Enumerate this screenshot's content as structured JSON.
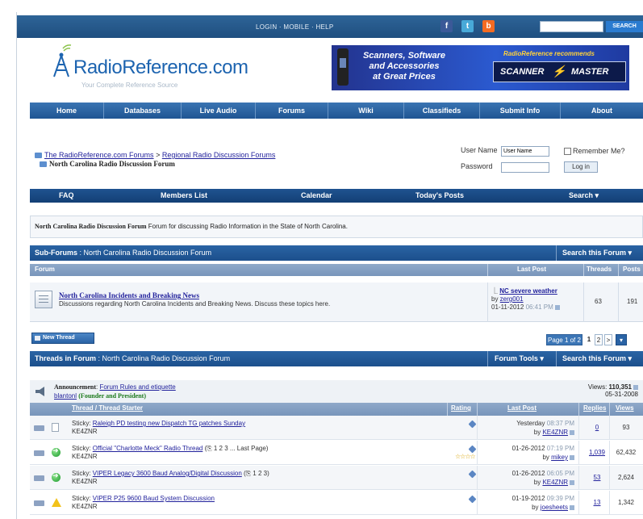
{
  "topbar": {
    "links": "LOGIN · MOBILE · HELP",
    "social": [
      "f",
      "t",
      "b"
    ],
    "search_button": "SEARCH"
  },
  "logo": {
    "name": "RadioReference.com",
    "tagline": "Your Complete Reference Source"
  },
  "banner": {
    "line1": "Scanners, Software",
    "line2": "and Accessories",
    "line3": "at Great Prices",
    "recommends": "RadioReference recommends",
    "brand_left": "SCANNER",
    "brand_right": "MASTER"
  },
  "nav": [
    "Home",
    "Databases",
    "Live Audio",
    "Forums",
    "Wiki",
    "Classifieds",
    "Submit Info",
    "About"
  ],
  "breadcrumb": {
    "link1": "The RadioReference.com Forums",
    "sep": " > ",
    "link2": "Regional Radio Discussion Forums",
    "current": "North Carolina Radio Discussion Forum"
  },
  "login": {
    "username_label": "User Name",
    "username_value": "User Name",
    "remember_label": "Remember Me?",
    "password_label": "Password",
    "button": "Log in"
  },
  "subnav": [
    "FAQ",
    "Members List",
    "Calendar",
    "Today's Posts",
    "Search ▾"
  ],
  "description": {
    "title": "North Carolina Radio Discussion Forum",
    "text": " Forum for discussing Radio Information in the State of North Carolina."
  },
  "subforums": {
    "bar_title": "Sub-Forums",
    "bar_rest": " : North Carolina Radio Discussion Forum",
    "search": "Search this Forum ▾",
    "col_forum": "Forum",
    "col_lastpost": "Last Post",
    "col_threads": "Threads",
    "col_posts": "Posts",
    "row": {
      "title": "North Carolina Incidents and Breaking News",
      "desc": "Discussions regarding North Carolina Incidents and Breaking News. Discuss these topics here.",
      "lp_title": "NC severe weather",
      "lp_by": "by ",
      "lp_user": "zerg001",
      "lp_date": "01-11-2012",
      "lp_time": "06:41 PM",
      "threads": "63",
      "posts": "191"
    }
  },
  "toolbar": {
    "new_thread": "New Thread",
    "page_of": "Page 1 of 2",
    "page_current": "1",
    "page_2": "2",
    "page_next": ">"
  },
  "threads": {
    "bar_title": "Threads in Forum",
    "bar_rest": " : North Carolina Radio Discussion Forum",
    "tools": "Forum Tools ▾",
    "search": "Search this Forum ▾",
    "announcement": {
      "label": "Announcement",
      "title": "Forum Rules and etiquette",
      "user": "blantonl",
      "role": "(Founder and President)",
      "views_label": "Views: ",
      "views": "110,351",
      "date": "05-31-2008"
    },
    "columns": {
      "thread": "Thread / Thread Starter",
      "rating": "Rating",
      "lastpost": "Last Post",
      "replies": "Replies",
      "views": "Views"
    },
    "rows": [
      {
        "prefix": "Sticky: ",
        "title": "Raleigh PD testing new Dispatch TG patches Sunday",
        "pages": "",
        "starter": "KE4ZNR",
        "date": "Yesterday",
        "time": "08:37 PM",
        "by": "KE4ZNR",
        "replies": "0",
        "views": "93",
        "icon": "page",
        "stars": ""
      },
      {
        "prefix": "Sticky: ",
        "title": "Official \"Charlotte Meck\" Radio Thread",
        "pages": " (⎘ 1 2 3 ... Last Page)",
        "starter": "KE4ZNR",
        "date": "01-26-2012",
        "time": "07:19 PM",
        "by": "mikey",
        "replies": "1,039",
        "views": "62,432",
        "icon": "green",
        "stars": "☆☆☆☆"
      },
      {
        "prefix": "Sticky: ",
        "title": "VIPER Legacy 3600 Baud Analog/Digital Discussion",
        "pages": " (⎘ 1 2 3)",
        "starter": "KE4ZNR",
        "date": "01-26-2012",
        "time": "06:05 PM",
        "by": "KE4ZNR",
        "replies": "53",
        "views": "2,624",
        "icon": "green",
        "stars": ""
      },
      {
        "prefix": "Sticky: ",
        "title": "VIPER P25 9600 Baud System Discussion",
        "pages": "",
        "starter": "KE4ZNR",
        "date": "01-19-2012",
        "time": "09:39 PM",
        "by": "joesheets",
        "replies": "13",
        "views": "1,342",
        "icon": "warn",
        "stars": ""
      }
    ]
  },
  "colors": {
    "nav_blue": "#1f5593",
    "header_bar": "#1c4f8c",
    "link": "#22229c"
  }
}
